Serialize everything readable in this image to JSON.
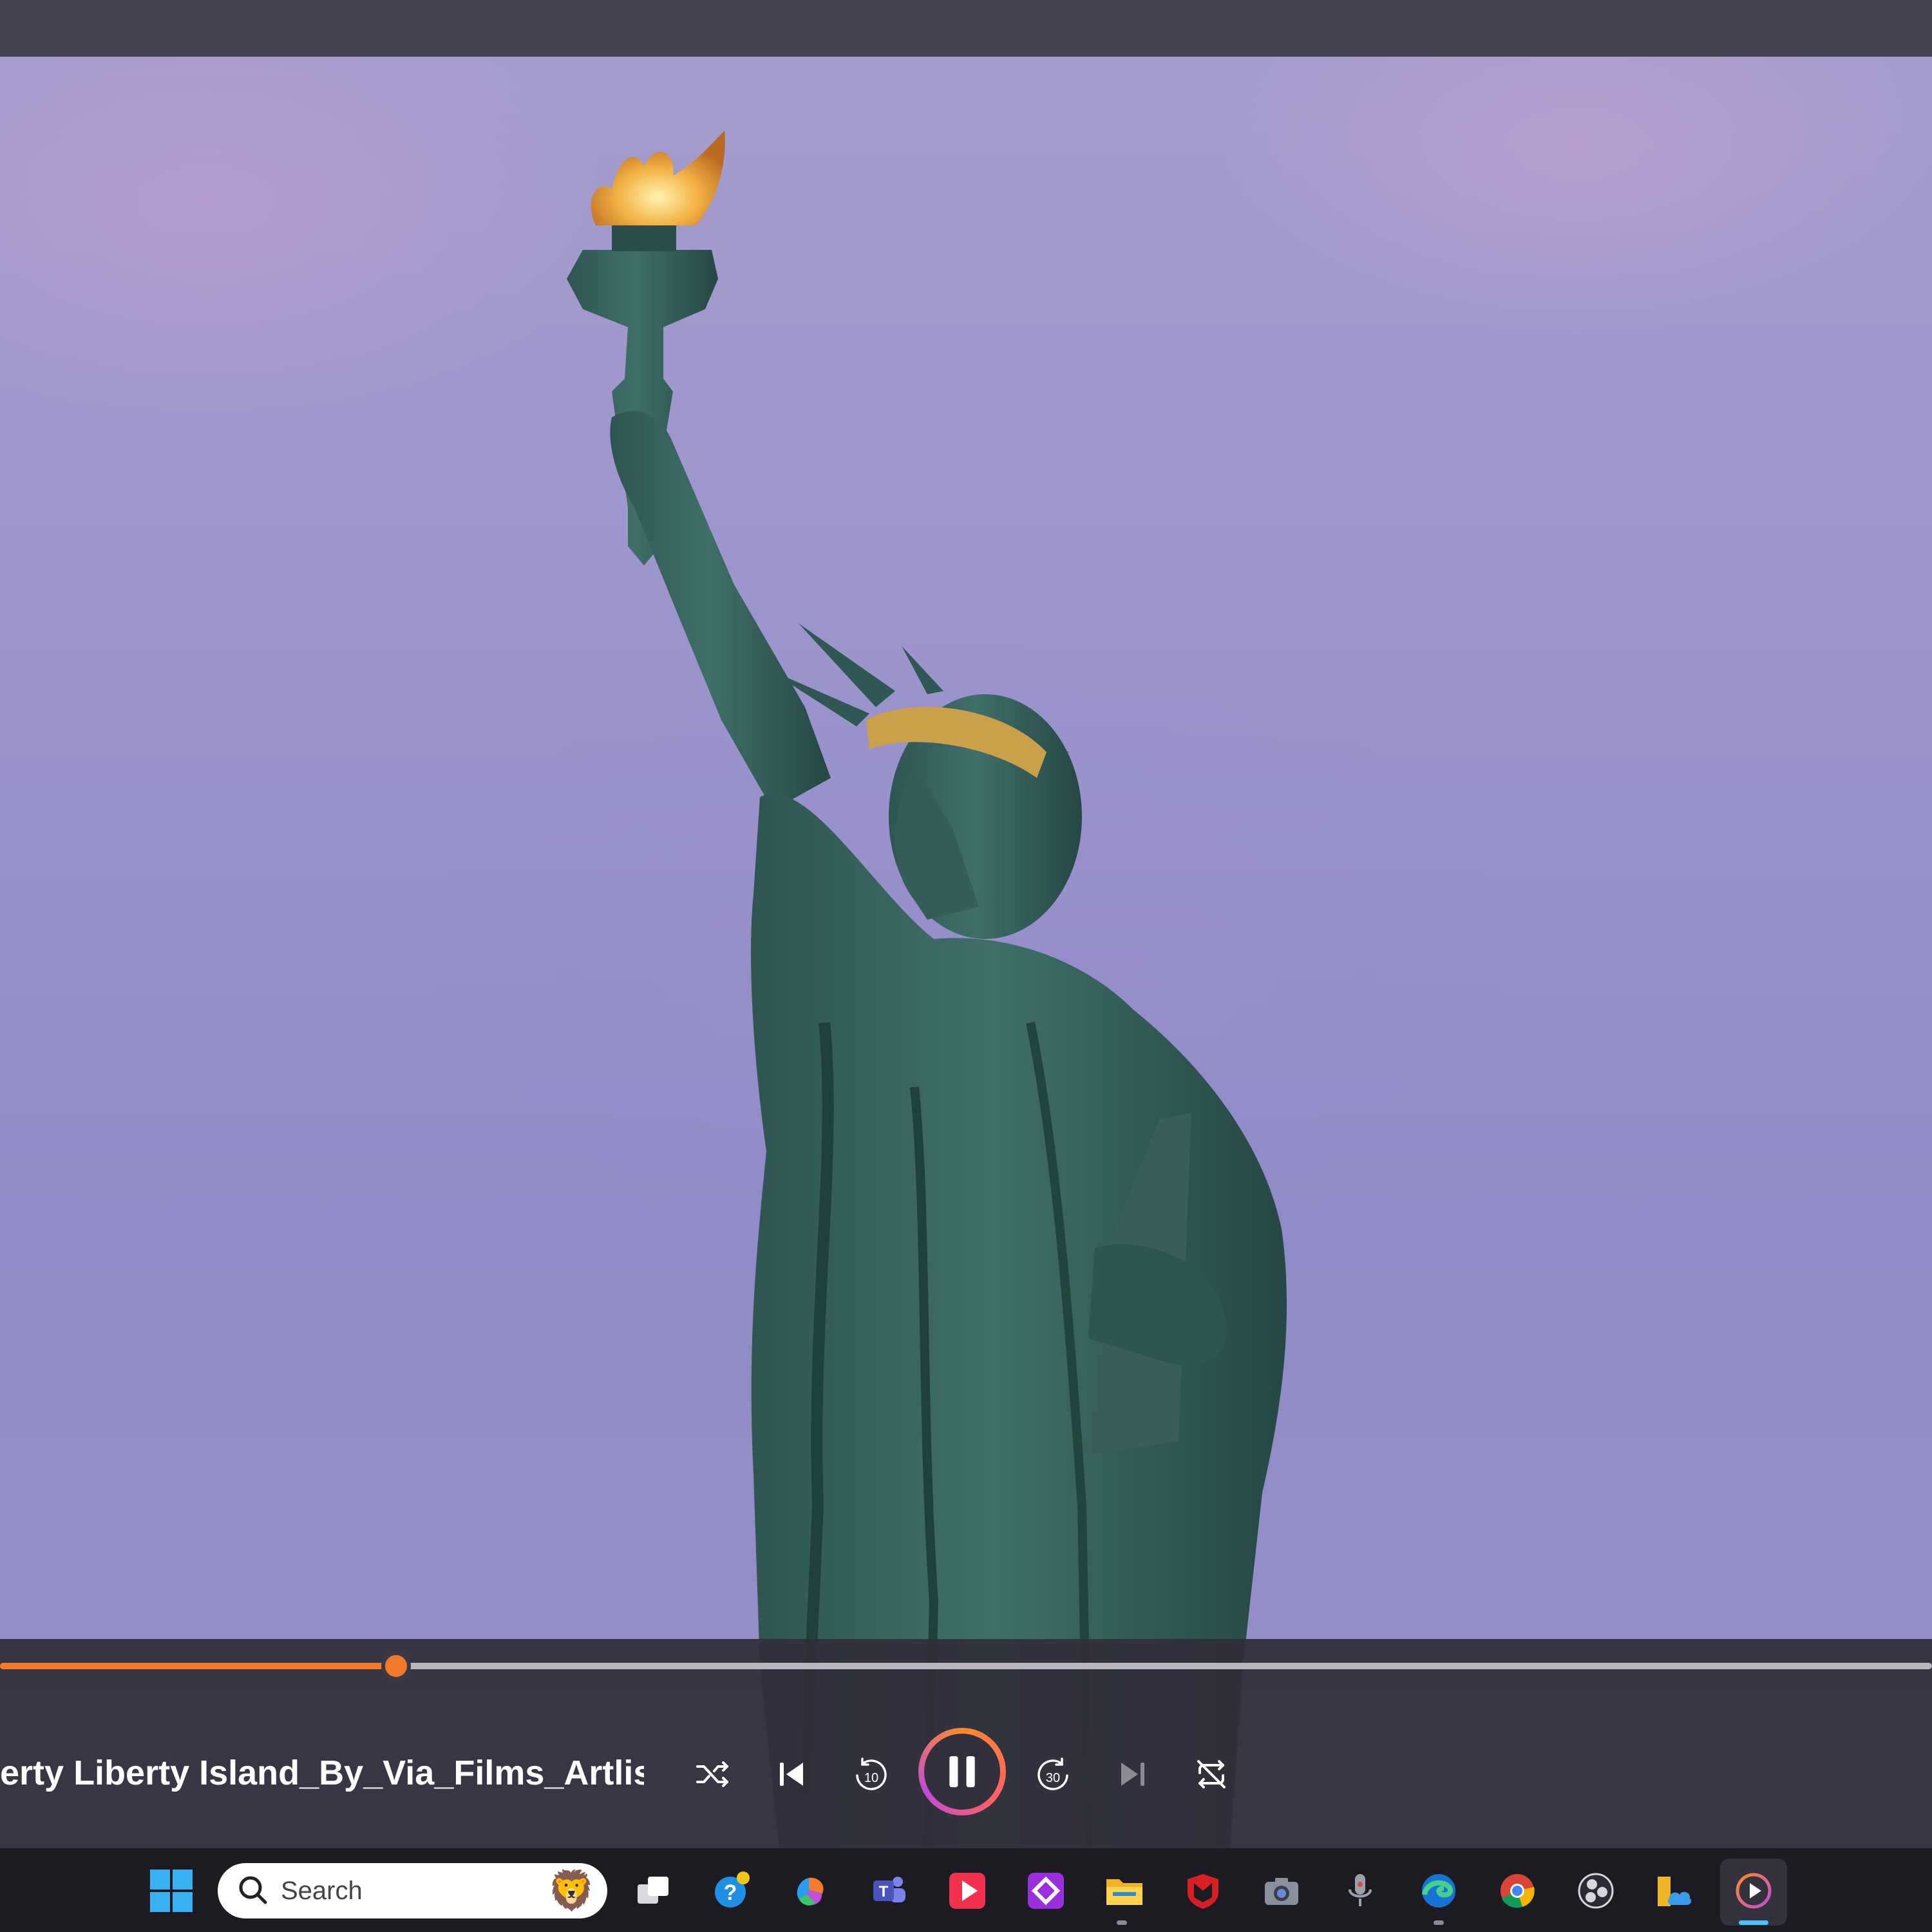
{
  "player": {
    "now_playing_title": "erty Liberty Island_By_Via_Films_Artlist...",
    "progress": 0.205,
    "state": "playing",
    "accent_color": "#f07a2a",
    "controls": [
      {
        "name": "shuffle",
        "icon": "shuffle-icon"
      },
      {
        "name": "previous",
        "icon": "skip-previous-icon"
      },
      {
        "name": "rewind-10",
        "icon": "rewind-10-icon",
        "label": "10"
      },
      {
        "name": "pause",
        "icon": "pause-icon"
      },
      {
        "name": "forward-30",
        "icon": "forward-30-icon",
        "label": "30"
      },
      {
        "name": "next",
        "icon": "skip-next-icon"
      },
      {
        "name": "repeat-off",
        "icon": "repeat-off-icon"
      }
    ]
  },
  "taskbar": {
    "search_placeholder": "Search",
    "apps": [
      {
        "name": "start",
        "icon": "windows-logo-icon"
      },
      {
        "name": "task-view",
        "icon": "task-view-icon"
      },
      {
        "name": "get-help",
        "icon": "help-icon"
      },
      {
        "name": "copilot",
        "icon": "copilot-icon"
      },
      {
        "name": "teams",
        "icon": "teams-icon"
      },
      {
        "name": "video-app",
        "icon": "play-app-icon"
      },
      {
        "name": "purple-app",
        "icon": "diamond-app-icon"
      },
      {
        "name": "file-explorer",
        "icon": "folder-icon"
      },
      {
        "name": "mcafee",
        "icon": "mcafee-shield-icon"
      },
      {
        "name": "camera",
        "icon": "camera-icon"
      },
      {
        "name": "voice-recorder",
        "icon": "microphone-icon"
      },
      {
        "name": "edge",
        "icon": "edge-icon"
      },
      {
        "name": "chrome",
        "icon": "chrome-icon"
      },
      {
        "name": "obs-studio",
        "icon": "obs-icon"
      },
      {
        "name": "files-cloud",
        "icon": "folder-cloud-icon"
      },
      {
        "name": "media-player",
        "icon": "media-player-icon",
        "active": true
      }
    ]
  }
}
